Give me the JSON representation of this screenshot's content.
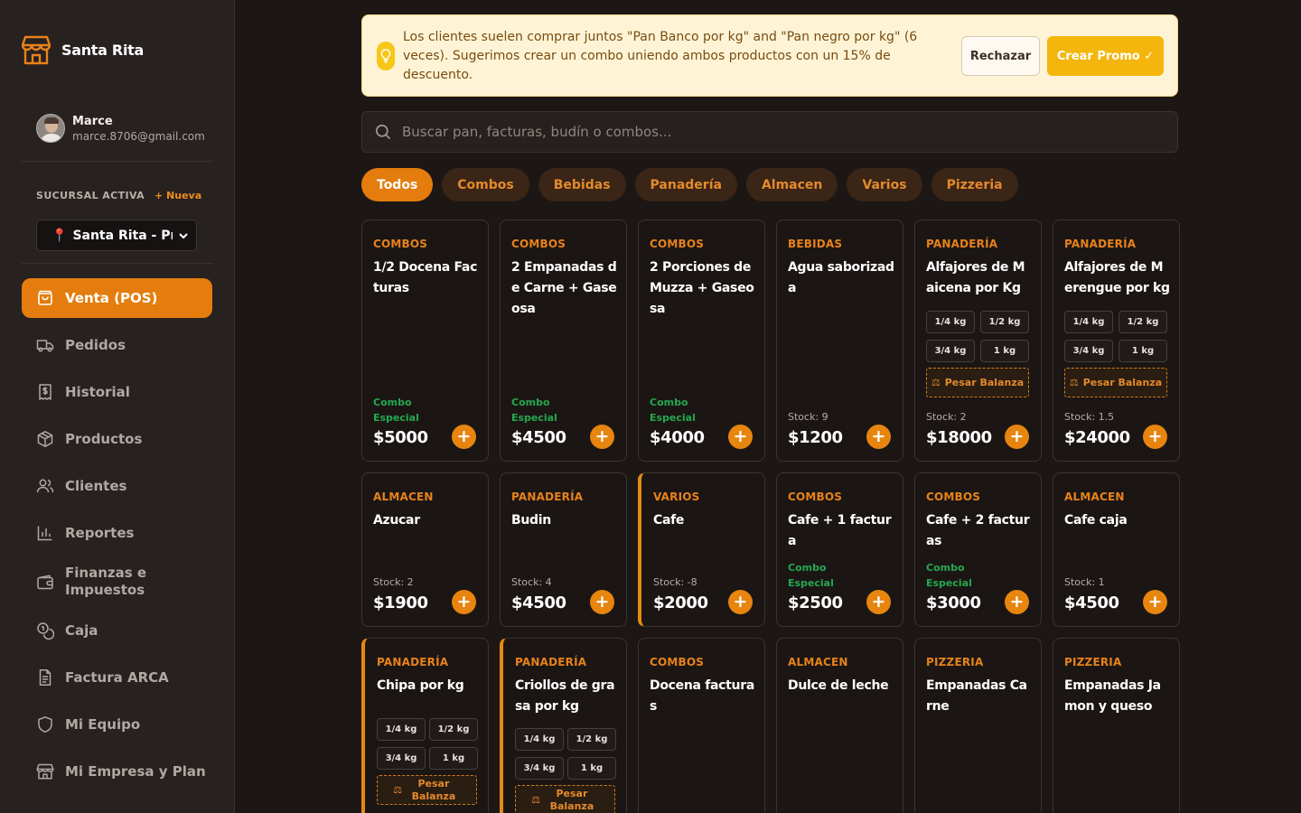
{
  "app": {
    "name": "Santa Rita"
  },
  "user": {
    "name": "Marce",
    "email": "marce.8706@gmail.com"
  },
  "branch": {
    "label": "SUCURSAL ACTIVA",
    "new_label": "+ Nueva",
    "value": "Santa Rita - Principal"
  },
  "nav": [
    {
      "label": "Venta (POS)",
      "icon": "shopping-bag-icon",
      "active": true
    },
    {
      "label": "Pedidos",
      "icon": "truck-icon"
    },
    {
      "label": "Historial",
      "icon": "receipt-dollar-icon"
    },
    {
      "label": "Productos",
      "icon": "package-icon"
    },
    {
      "label": "Clientes",
      "icon": "users-icon"
    },
    {
      "label": "Reportes",
      "icon": "bar-chart-icon"
    },
    {
      "label": "Finanzas e Impuestos",
      "icon": "wallet-icon"
    },
    {
      "label": "Caja",
      "icon": "coins-icon"
    },
    {
      "label": "Factura ARCA",
      "icon": "file-text-icon"
    },
    {
      "label": "Mi Equipo",
      "icon": "shield-icon"
    },
    {
      "label": "Mi Empresa y Plan",
      "icon": "store-icon"
    }
  ],
  "promo": {
    "text": "Los clientes suelen comprar juntos \"Pan Banco por kg\" and \"Pan negro por kg\" (6 veces). Sugerimos crear un combo uniendo ambos productos con un 15% de descuento.",
    "reject_label": "Rechazar",
    "create_label": "Crear Promo ✓",
    "accent": "#f4b60c"
  },
  "search": {
    "placeholder": "Buscar pan, facturas, budín o combos..."
  },
  "categories": [
    "Todos",
    "Combos",
    "Bebidas",
    "Panadería",
    "Almacen",
    "Varios",
    "Pizzeria"
  ],
  "weights": [
    "1/4 kg",
    "1/2 kg",
    "3/4 kg",
    "1 kg"
  ],
  "scale_label": "Pesar Balanza",
  "combo_label_1": "Combo",
  "combo_label_2": "Especial",
  "products": [
    {
      "category": "COMBOS",
      "name": "1/2 Docena Facturas",
      "price": "$5000",
      "combo": true
    },
    {
      "category": "COMBOS",
      "name": "2 Empanadas de Carne + Gaseosa",
      "price": "$4500",
      "combo": true
    },
    {
      "category": "COMBOS",
      "name": "2 Porciones de Muzza + Gaseosa",
      "price": "$4000",
      "combo": true
    },
    {
      "category": "BEBIDAS",
      "name": "Agua saborizada",
      "stock": "Stock: 9",
      "price": "$1200"
    },
    {
      "category": "PANADERÍA",
      "name": "Alfajores de Maicena por Kg",
      "stock": "Stock: 2",
      "price": "$18000",
      "weighted": true
    },
    {
      "category": "PANADERÍA",
      "name": "Alfajores de Merengue por kg",
      "stock": "Stock: 1.5",
      "price": "$24000",
      "weighted": true
    },
    {
      "category": "ALMACEN",
      "name": "Azucar",
      "stock": "Stock: 2",
      "price": "$1900"
    },
    {
      "category": "PANADERÍA",
      "name": "Budin",
      "stock": "Stock: 4",
      "price": "$4500"
    },
    {
      "category": "VARIOS",
      "name": "Cafe",
      "stock": "Stock: -8",
      "price": "$2000",
      "highlight": true
    },
    {
      "category": "COMBOS",
      "name": "Cafe + 1 factura",
      "price": "$2500",
      "combo": true
    },
    {
      "category": "COMBOS",
      "name": "Cafe + 2 facturas",
      "price": "$3000",
      "combo": true
    },
    {
      "category": "ALMACEN",
      "name": "Cafe caja",
      "stock": "Stock: 1",
      "price": "$4500"
    },
    {
      "category": "PANADERÍA",
      "name": "Chipa por kg",
      "weighted": true,
      "highlight": true
    },
    {
      "category": "PANADERÍA",
      "name": "Criollos de grasa por kg",
      "weighted": true,
      "highlight": true
    },
    {
      "category": "COMBOS",
      "name": "Docena facturas"
    },
    {
      "category": "ALMACEN",
      "name": "Dulce de leche"
    },
    {
      "category": "PIZZERIA",
      "name": "Empanadas Carne"
    },
    {
      "category": "PIZZERIA",
      "name": "Empanadas Jamon y queso"
    }
  ]
}
